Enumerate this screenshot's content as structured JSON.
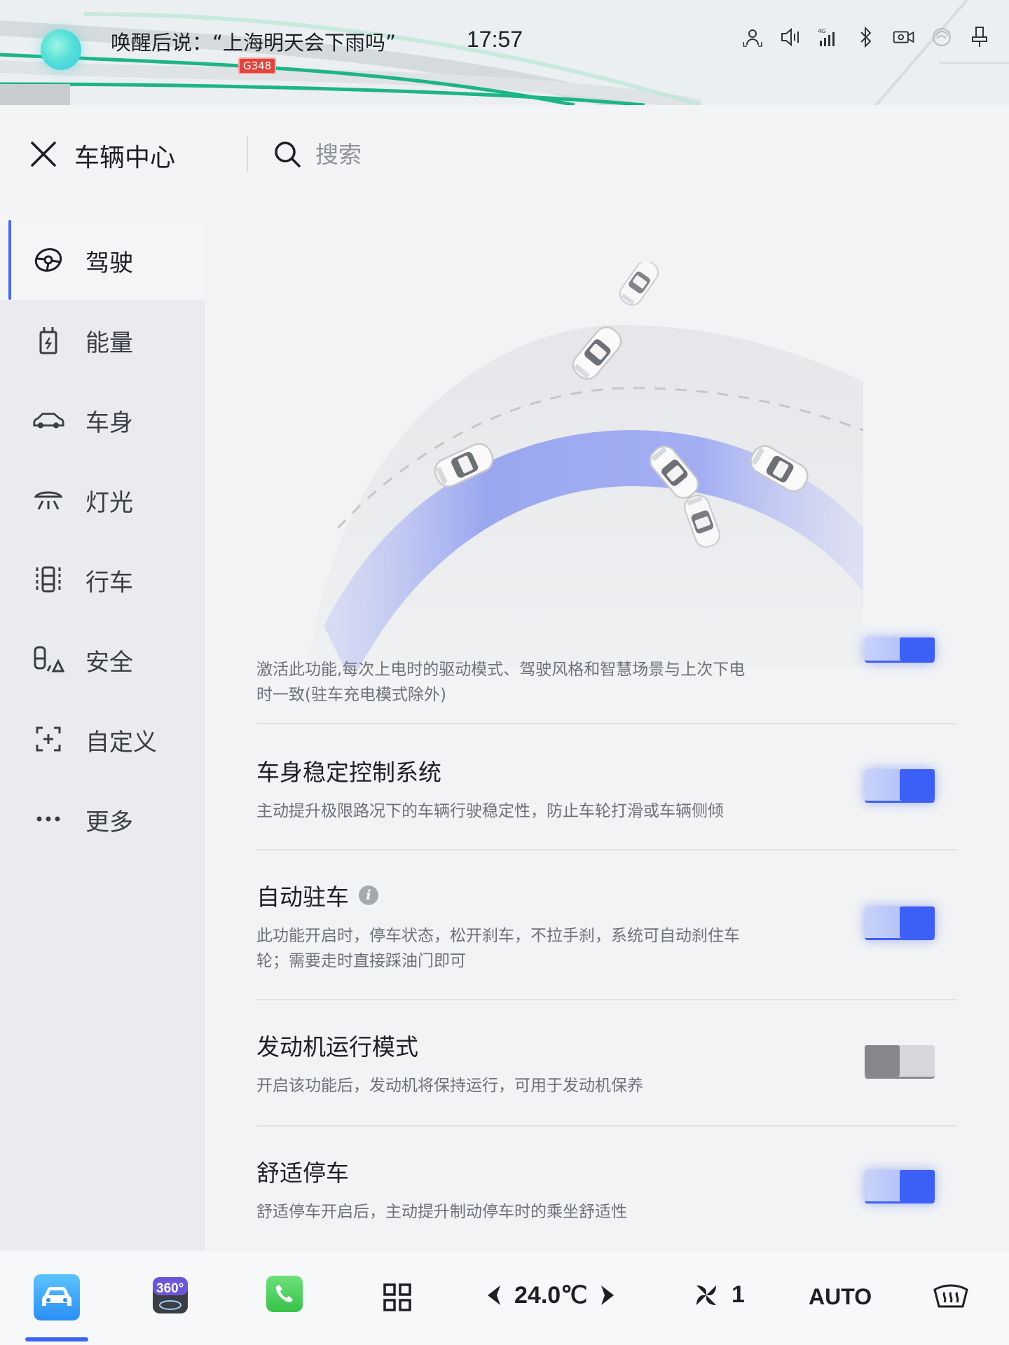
{
  "status": {
    "voice_hint": "唤醒后说：“上海明天会下雨吗”",
    "road_badge": "G348",
    "time": "17:57",
    "icons": [
      "driver-monitor-icon",
      "volume-icon",
      "signal-4g-icon",
      "bluetooth-icon",
      "dashcam-icon",
      "wireless-charge-icon",
      "usb-icon"
    ]
  },
  "header": {
    "title": "车辆中心",
    "search_placeholder": "搜索"
  },
  "sidebar": {
    "items": [
      {
        "label": "驾驶",
        "icon": "steering-icon",
        "active": true
      },
      {
        "label": "能量",
        "icon": "energy-icon",
        "active": false
      },
      {
        "label": "车身",
        "icon": "car-body-icon",
        "active": false
      },
      {
        "label": "灯光",
        "icon": "light-icon",
        "active": false
      },
      {
        "label": "行车",
        "icon": "driving-icon",
        "active": false
      },
      {
        "label": "安全",
        "icon": "safety-icon",
        "active": false
      },
      {
        "label": "自定义",
        "icon": "custom-icon",
        "active": false
      },
      {
        "label": "更多",
        "icon": "more-icon",
        "active": false
      }
    ]
  },
  "settings": {
    "partial_desc": "激活此功能,每次上电时的驱动模式、驾驶风格和智慧场景与上次下电时一致(驻车充电模式除外)",
    "partial_on": true,
    "rows": [
      {
        "title": "车身稳定控制系统",
        "desc": "主动提升极限路况下的车辆行驶稳定性，防止车轮打滑或车辆侧倾",
        "on": true
      },
      {
        "title": "自动驻车",
        "desc": "此功能开启时，停车状态，松开刹车，不拉手刹，系统可自动刹住车轮；需要走时直接踩油门即可",
        "on": true,
        "info": true
      },
      {
        "title": "发动机运行模式",
        "desc": "开启该功能后，发动机将保持运行，可用于发动机保养",
        "on": false
      },
      {
        "title": "舒适停车",
        "desc": "舒适停车开启后，主动提升制动停车时的乘坐舒适性",
        "on": true
      }
    ]
  },
  "dock": {
    "temperature": "24.0℃",
    "fan_level": "1",
    "auto_label": "AUTO",
    "cam_label": "360°",
    "accent": "#3c5ff5"
  }
}
